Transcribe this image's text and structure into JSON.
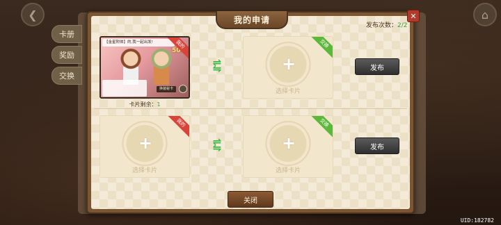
{
  "background": {
    "side_tabs": [
      "卡册",
      "奖励",
      "交换"
    ],
    "uid": "UID:182782"
  },
  "modal": {
    "title": "我的申请",
    "publish_count_label": "发布次数：",
    "publish_count_value": "2/2",
    "tag_mine": "我的",
    "tag_swap": "交换",
    "rows": [
      {
        "my_card": {
          "title": "【金星附体】的,我一起出发!",
          "number": "500",
          "badge": "换装秘卡",
          "remaining_label": "卡片剩余：",
          "remaining_value": "1"
        },
        "swap_slot_label": "选择卡片",
        "publish_label": "发布"
      },
      {
        "my_slot_label": "选择卡片",
        "swap_slot_label": "选择卡片",
        "publish_label": "发布"
      }
    ],
    "close_label": "关闭"
  },
  "colors": {
    "accent_green": "#3fb84a",
    "tag_red": "#d9443a",
    "frame_brown": "#7a5632"
  }
}
